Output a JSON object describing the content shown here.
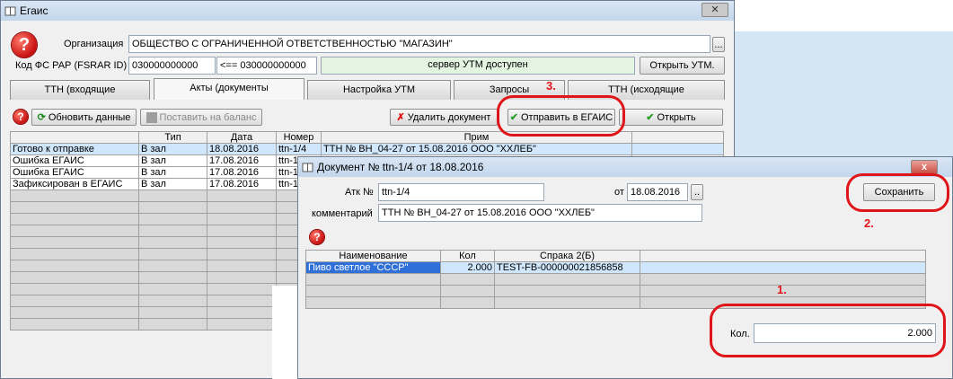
{
  "main_window": {
    "title": "Егаис",
    "org_label": "Организация",
    "org_value": "ОБЩЕСТВО С ОГРАНИЧЕННОЙ ОТВЕТСТВЕННОСТЬЮ \"МАГАЗИН\"",
    "ellipsis": "...",
    "fsrar_label": "Код ФС РАР (FSRAR ID)",
    "fsrar_value": "030000000000",
    "fsrar_value2": "<== 030000000000",
    "server_status": "сервер УТМ доступен",
    "open_utm": "Открыть УТМ.",
    "tabs": [
      "ТТН (входящие",
      "Акты (документы",
      "Настройка УТМ",
      "Запросы",
      "ТТН (исходящие"
    ],
    "toolbar": {
      "refresh": "Обновить данные",
      "balance": "Поставить на баланс",
      "delete": "Удалить документ",
      "send": "Отправить в ЕГАИС",
      "open": "Открыть"
    },
    "table": {
      "headers": [
        "",
        "Тип",
        "Дата",
        "Номер",
        "Прим"
      ],
      "rows": [
        [
          "Готово к отправке",
          "В зал",
          "18.08.2016",
          "ttn-1/4",
          "ТТН № ВН_04-27 от 15.08.2016 ООО \"ХХЛЕБ\""
        ],
        [
          "Ошибка ЕГАИС",
          "В зал",
          "17.08.2016",
          "ttn-1",
          ""
        ],
        [
          "Ошибка ЕГАИС",
          "В зал",
          "17.08.2016",
          "ttn-1",
          ""
        ],
        [
          "Зафиксирован в ЕГАИС",
          "В зал",
          "17.08.2016",
          "ttn-1",
          ""
        ]
      ]
    }
  },
  "doc_window": {
    "title": "Документ  № ttn-1/4 от 18.08.2016",
    "close": "x",
    "act_label": "Атк №",
    "act_value": "ttn-1/4",
    "from_label": "от",
    "date_value": "18.08.2016",
    "ellipsis": "..",
    "comment_label": "комментарий",
    "comment_value": "ТТН № ВН_04-27 от 15.08.2016 ООО \"ХХЛЕБ\"",
    "save": "Сохранить",
    "table": {
      "headers": [
        "Наименование",
        "Кол",
        "Спрака 2(Б)"
      ],
      "rows": [
        [
          "Пиво светлое \"СССР\"",
          "2.000",
          "TEST-FB-000000021856858"
        ]
      ]
    },
    "qty_label": "Кол.",
    "qty_value": "2.000"
  },
  "annotations": [
    "1.",
    "2.",
    "3."
  ],
  "colors": {
    "annotation": "#e0151a",
    "selection": "#2e6fd9",
    "row_highlight": "#cfe6fb"
  }
}
